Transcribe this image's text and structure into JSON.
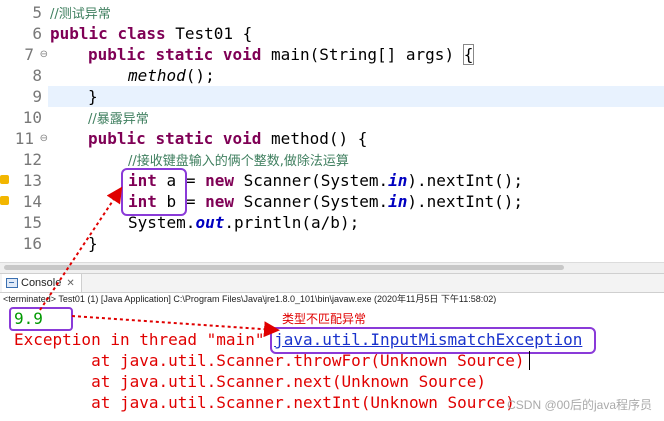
{
  "editor": {
    "lines": [
      {
        "n": "5",
        "fold": "",
        "comment": "//测试异常"
      },
      {
        "n": "6",
        "fold": ""
      },
      {
        "n": "7",
        "fold": "⊖"
      },
      {
        "n": "8",
        "fold": ""
      },
      {
        "n": "9",
        "fold": ""
      },
      {
        "n": "10",
        "fold": "",
        "comment": "//暴露异常"
      },
      {
        "n": "11",
        "fold": "⊖"
      },
      {
        "n": "12",
        "fold": "",
        "comment": "//接收键盘输入的俩个整数,做除法运算"
      },
      {
        "n": "13",
        "fold": ""
      },
      {
        "n": "14",
        "fold": ""
      },
      {
        "n": "15",
        "fold": ""
      },
      {
        "n": "16",
        "fold": ""
      }
    ],
    "tokens": {
      "public": "public",
      "class": "class",
      "class_name": "Test01 {",
      "static": "static",
      "void": "void",
      "main_sig": "main(String[] args) ",
      "open_brace": "{",
      "method_call": "method",
      "method_call_end": "();",
      "close_brace": "}",
      "method_sig": "method() {",
      "int": "int",
      "var_a": "a",
      "var_b": "b",
      "eq": " = ",
      "new": "new",
      "scanner_pre": " Scanner(System.",
      "in_field": "in",
      "scanner_post": ").nextInt();",
      "println_pre": "System.",
      "out_field": "out",
      "println_post": ".println(a/b);"
    }
  },
  "console": {
    "tab_label": "Console",
    "tab_close": "✕",
    "info": "<terminated> Test01 (1) [Java Application] C:\\Program Files\\Java\\jre1.8.0_101\\bin\\javaw.exe (2020年11月5日 下午11:58:02)",
    "input_echo": "9.9",
    "exception_prefix": "Exception in thread \"main\" ",
    "exception_class": "java.util.InputMismatchException",
    "stack": [
      "        at java.util.Scanner.throwFor(Unknown Source)",
      "        at java.util.Scanner.next(Unknown Source)",
      "        at java.util.Scanner.nextInt(Unknown Source)"
    ],
    "annotation": "类型不匹配异常",
    "watermark": "CSDN @00后的java程序员"
  },
  "colors": {
    "keyword": "#7f0055",
    "comment": "#3f7f5f",
    "field": "#0000c0",
    "error": "#e00000",
    "input": "#009900",
    "highlight_box": "#8a3ad8"
  }
}
